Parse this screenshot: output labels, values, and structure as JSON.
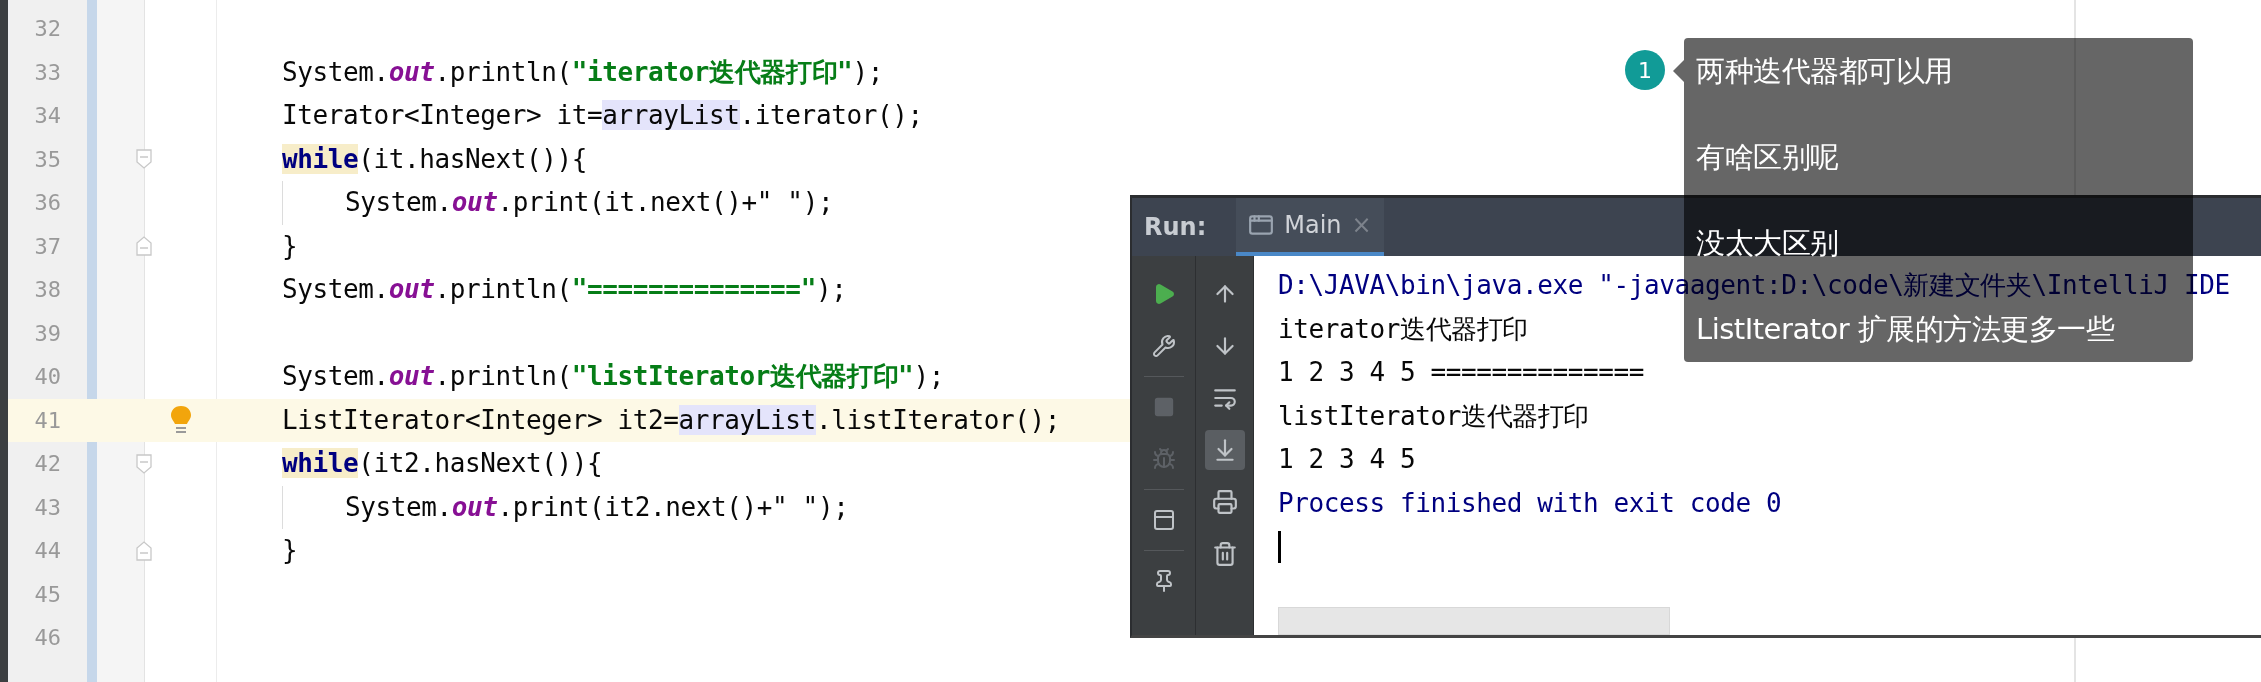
{
  "editor": {
    "lines": [
      {
        "number": "32",
        "current": false,
        "guide": false
      },
      {
        "number": "33",
        "current": false,
        "guide": false,
        "tokens": [
          {
            "kind": "text",
            "text": "System."
          },
          {
            "kind": "field",
            "text": "out"
          },
          {
            "kind": "text",
            "text": ".println("
          },
          {
            "kind": "string",
            "text": "\"iterator迭代器打印\""
          },
          {
            "kind": "text",
            "text": ");"
          }
        ]
      },
      {
        "number": "34",
        "current": false,
        "guide": false,
        "tokens": [
          {
            "kind": "text",
            "text": "Iterator<Integer> it="
          },
          {
            "kind": "ref",
            "text": "arrayList"
          },
          {
            "kind": "text",
            "text": ".iterator();"
          }
        ]
      },
      {
        "number": "35",
        "current": false,
        "guide": false,
        "fold_start": true,
        "tokens": [
          {
            "kind": "keyword",
            "text": "while"
          },
          {
            "kind": "text",
            "text": "(it.hasNext()){"
          }
        ]
      },
      {
        "number": "36",
        "current": false,
        "guide": true,
        "tokens": [
          {
            "kind": "text",
            "text": "System."
          },
          {
            "kind": "field",
            "text": "out"
          },
          {
            "kind": "text",
            "text": ".print(it.next()+"
          },
          {
            "kind": "string_plain",
            "text": "\" \""
          },
          {
            "kind": "text",
            "text": ");"
          }
        ]
      },
      {
        "number": "37",
        "current": false,
        "guide": false,
        "fold_end": true,
        "tokens": [
          {
            "kind": "text",
            "text": "}"
          }
        ]
      },
      {
        "number": "38",
        "current": false,
        "guide": false,
        "tokens": [
          {
            "kind": "text",
            "text": "System."
          },
          {
            "kind": "field",
            "text": "out"
          },
          {
            "kind": "text",
            "text": ".println("
          },
          {
            "kind": "string",
            "text": "\"==============\""
          },
          {
            "kind": "text",
            "text": ");"
          }
        ]
      },
      {
        "number": "39",
        "current": false,
        "guide": false
      },
      {
        "number": "40",
        "current": false,
        "guide": false,
        "tokens": [
          {
            "kind": "text",
            "text": "System."
          },
          {
            "kind": "field",
            "text": "out"
          },
          {
            "kind": "text",
            "text": ".println("
          },
          {
            "kind": "string",
            "text": "\"listIterator迭代器打印\""
          },
          {
            "kind": "text",
            "text": ");"
          }
        ]
      },
      {
        "number": "41",
        "current": true,
        "guide": false,
        "bulb": true,
        "tokens": [
          {
            "kind": "text",
            "text": "ListIterator<Integer> it2="
          },
          {
            "kind": "ref",
            "text": "arrayList"
          },
          {
            "kind": "text",
            "text": ".listIterator();"
          }
        ]
      },
      {
        "number": "42",
        "current": false,
        "guide": false,
        "fold_start": true,
        "tokens": [
          {
            "kind": "keyword",
            "text": "while"
          },
          {
            "kind": "text",
            "text": "(it2.hasNext()){"
          }
        ]
      },
      {
        "number": "43",
        "current": false,
        "guide": true,
        "tokens": [
          {
            "kind": "text",
            "text": "System."
          },
          {
            "kind": "field",
            "text": "out"
          },
          {
            "kind": "text",
            "text": ".print(it2.next()+"
          },
          {
            "kind": "string_plain",
            "text": "\" \""
          },
          {
            "kind": "text",
            "text": ");"
          }
        ]
      },
      {
        "number": "44",
        "current": false,
        "guide": false,
        "fold_end": true,
        "tokens": [
          {
            "kind": "text",
            "text": "}"
          }
        ]
      },
      {
        "number": "45",
        "current": false,
        "guide": false
      },
      {
        "number": "46",
        "current": false,
        "guide": false
      }
    ]
  },
  "run_panel": {
    "label": "Run:",
    "tabs": [
      {
        "label": "Main",
        "close": "×",
        "selected": true
      }
    ],
    "left_tools": [
      {
        "disabled": false
      },
      {
        "disabled": false
      },
      {
        "disabled": true
      },
      {
        "disabled": true
      },
      {
        "disabled": false
      },
      {
        "disabled": false
      }
    ],
    "right_tools": [
      {
        "selected": false
      },
      {
        "selected": false
      },
      {
        "selected": false
      },
      {
        "selected": true
      },
      {
        "selected": false
      },
      {
        "selected": false
      }
    ],
    "console": [
      {
        "kind": "system",
        "text": "D:\\JAVA\\bin\\java.exe \"-javaagent:D:\\code\\新建文件夹\\IntelliJ IDE"
      },
      {
        "kind": "output",
        "text": "iterator迭代器打印"
      },
      {
        "kind": "output",
        "text": "1 2 3 4 5 =============="
      },
      {
        "kind": "output",
        "text": "listIterator迭代器打印"
      },
      {
        "kind": "output",
        "text": "1 2 3 4 5"
      },
      {
        "kind": "system",
        "text": "Process finished with exit code 0"
      }
    ]
  },
  "annotation": {
    "badge": "1",
    "lines": [
      "两种迭代器都可以用",
      "有啥区别呢",
      "没太大区别",
      "ListIterator 扩展的方法更多一些"
    ]
  }
}
